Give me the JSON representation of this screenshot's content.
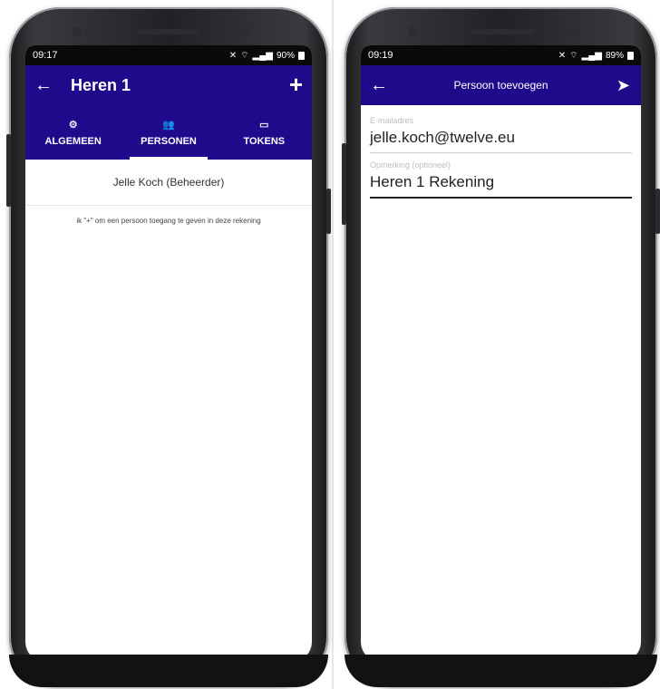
{
  "left": {
    "status": {
      "time": "09:17",
      "battery": "90%"
    },
    "appbar": {
      "title": "Heren 1"
    },
    "tabs": [
      {
        "label": "ALGEMEEN",
        "active": false
      },
      {
        "label": "PERSONEN",
        "active": true
      },
      {
        "label": "TOKENS",
        "active": false
      }
    ],
    "person": "Jelle Koch (Beheerder)",
    "hint": "ik \"+\" om een persoon toegang te geven in deze rekening"
  },
  "right": {
    "status": {
      "time": "09:19",
      "battery": "89%"
    },
    "appbar": {
      "title": "Persoon toevoegen"
    },
    "fields": [
      {
        "label": "E-mailadres",
        "value": "jelle.koch@twelve.eu"
      },
      {
        "label": "Opmerking (optioneel)",
        "value": "Heren 1 Rekening"
      }
    ]
  },
  "colors": {
    "appbar": "#1f0a8c",
    "tab_indicator": "#ffffff"
  }
}
